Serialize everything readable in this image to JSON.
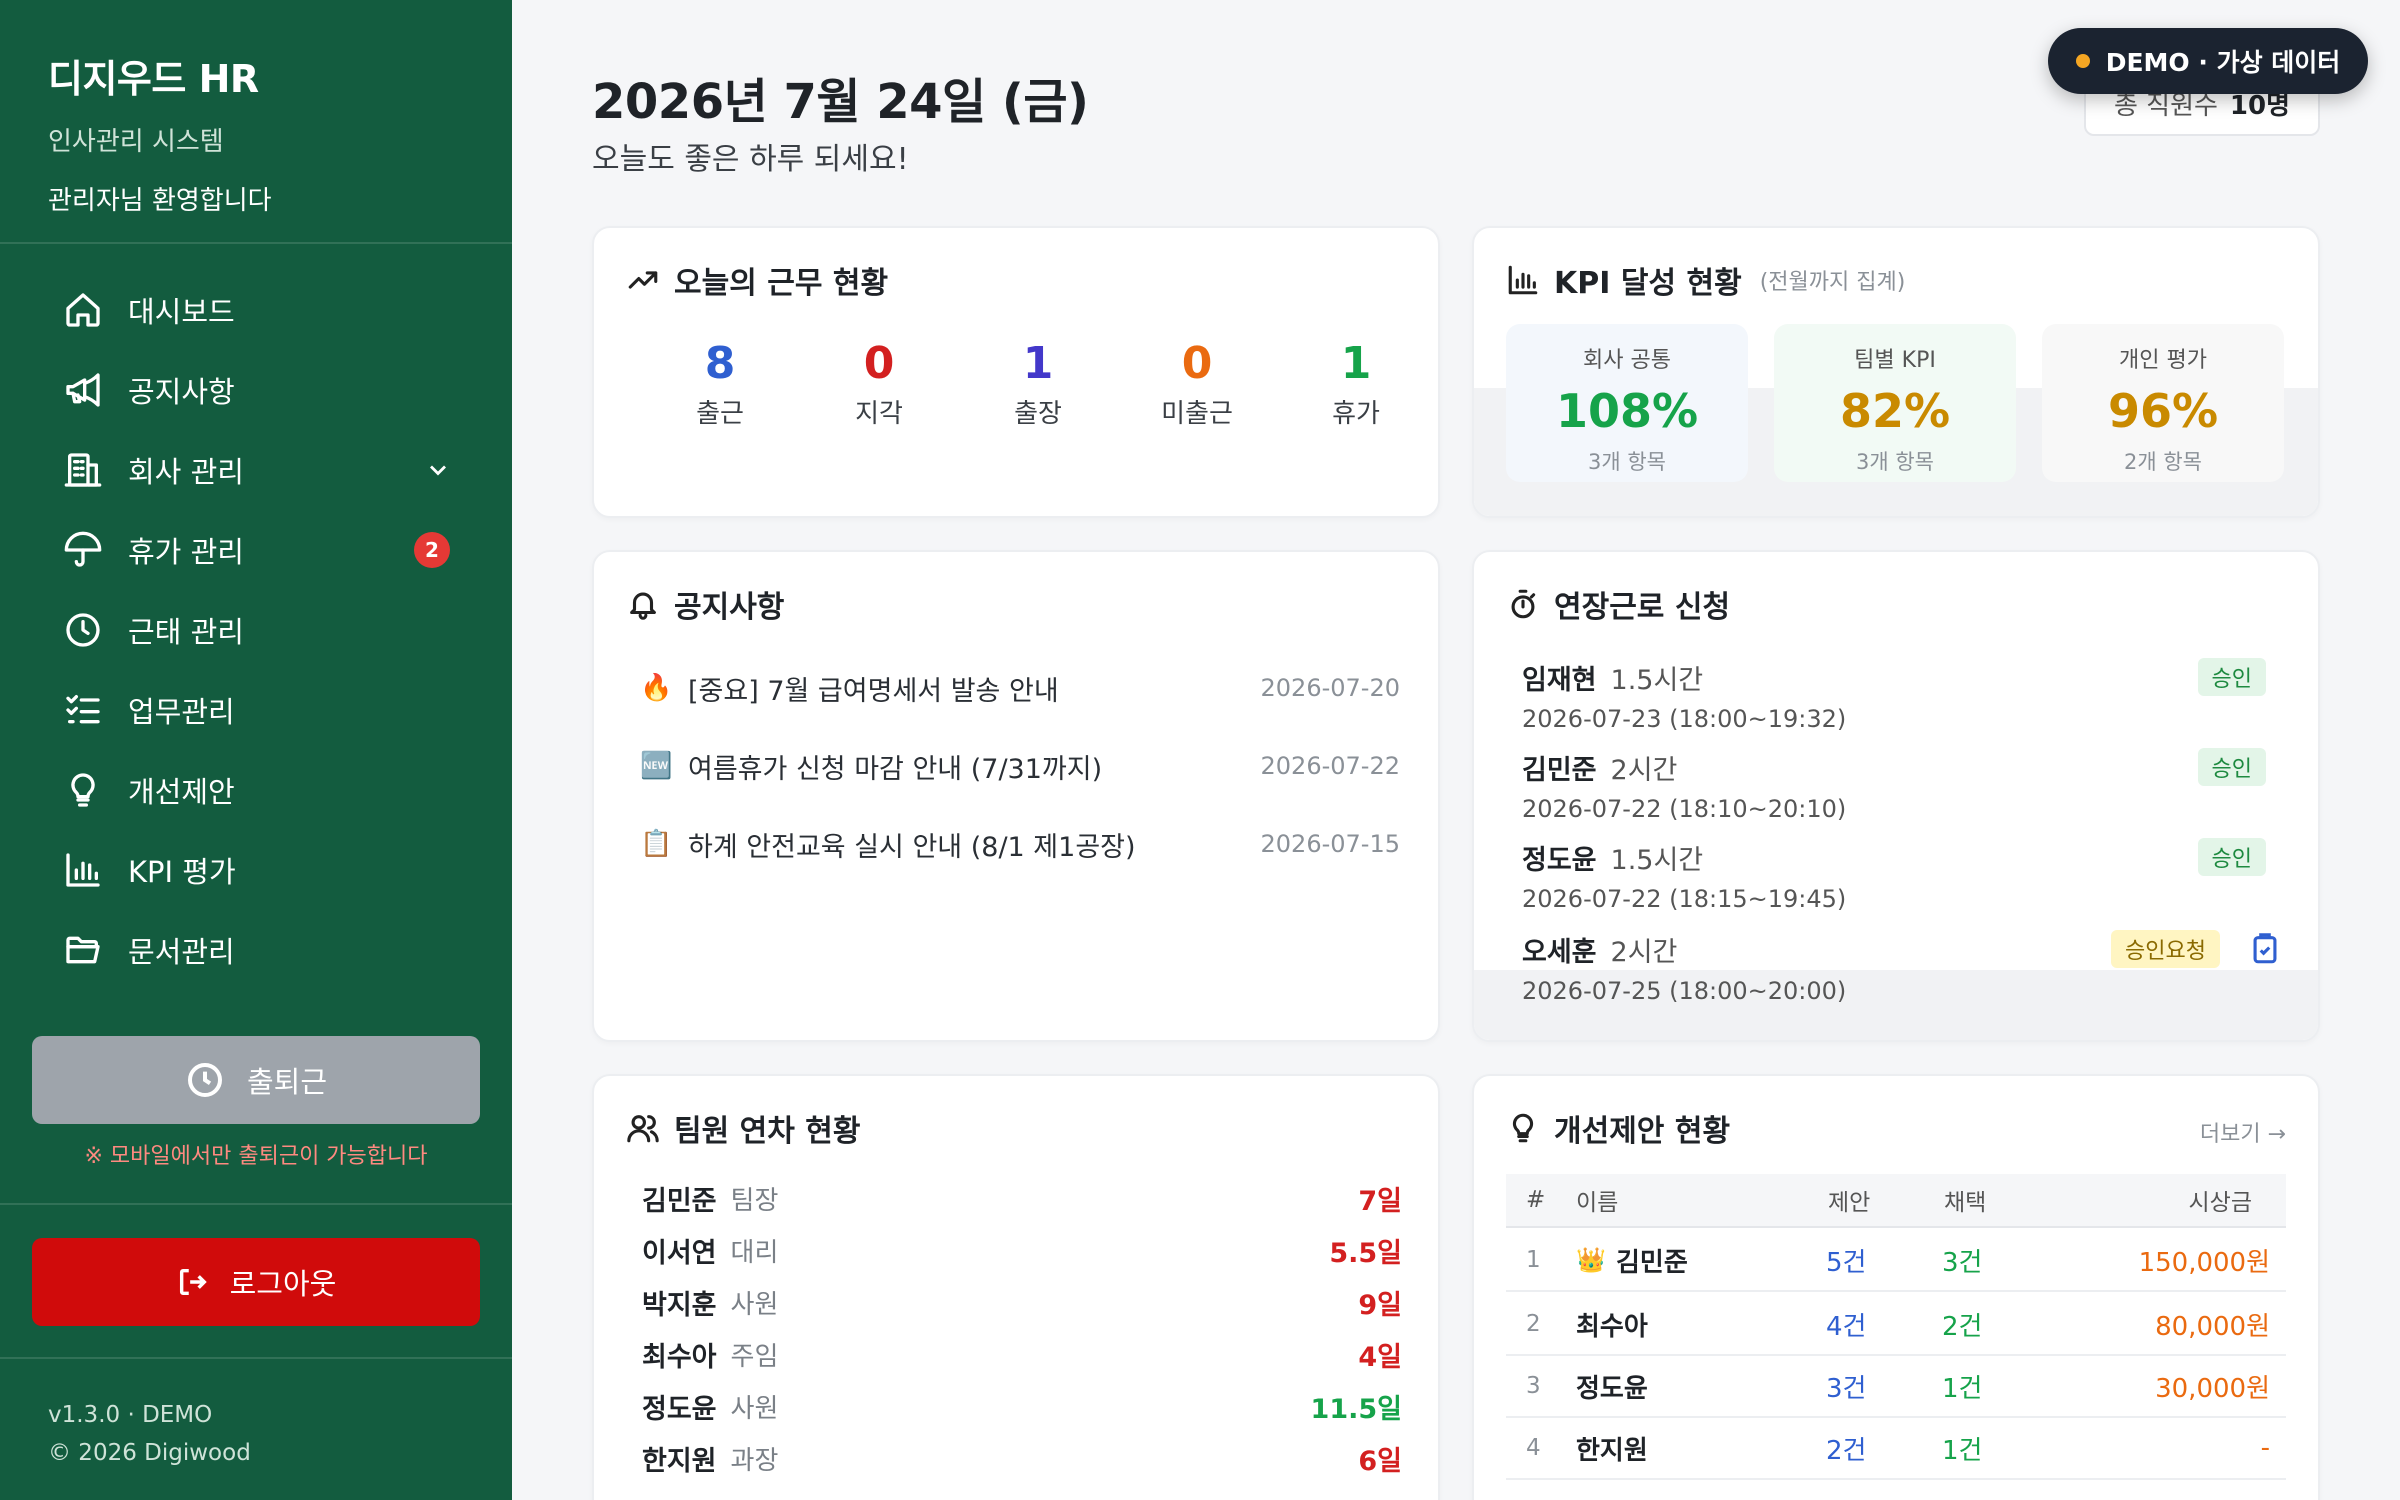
{
  "sidebar": {
    "brand": "디지우드 HR",
    "subtitle": "인사관리 시스템",
    "welcome": "관리자님 환영합니다",
    "nav": [
      {
        "label": "대시보드",
        "icon": "home-icon"
      },
      {
        "label": "공지사항",
        "icon": "megaphone-icon"
      },
      {
        "label": "회사 관리",
        "icon": "building-icon"
      },
      {
        "label": "휴가 관리",
        "icon": "umbrella-icon",
        "badge": "2"
      },
      {
        "label": "근태 관리",
        "icon": "clock-icon"
      },
      {
        "label": "업무관리",
        "icon": "tasklist-icon"
      },
      {
        "label": "개선제안",
        "icon": "lightbulb-icon"
      },
      {
        "label": "KPI 평가",
        "icon": "bar-chart-icon"
      },
      {
        "label": "문서관리",
        "icon": "folder-icon"
      }
    ],
    "clock_button": "출퇴근",
    "mobile_note": "※ 모바일에서만 출퇴근이 가능합니다",
    "logout": "로그아웃",
    "version": "v1.3.0 · DEMO",
    "copyright": "© 2026 Digiwood"
  },
  "header": {
    "date": "2026년 7월 24일 (금)",
    "greeting": "오늘도 좋은 하루 되세요!",
    "employees_label": "총 직원수",
    "employees_value": "10명",
    "demo_badge": "DEMO · 가상 데이터"
  },
  "attendance": {
    "title": "오늘의 근무 현황",
    "items": [
      {
        "value": "8",
        "label": "출근",
        "color": "#2f5fd0"
      },
      {
        "value": "0",
        "label": "지각",
        "color": "#d32020"
      },
      {
        "value": "1",
        "label": "출장",
        "color": "#4338ca"
      },
      {
        "value": "0",
        "label": "미출근",
        "color": "#ea6a10"
      },
      {
        "value": "1",
        "label": "휴가",
        "color": "#16a34a"
      }
    ]
  },
  "kpi": {
    "title": "KPI 달성 현황",
    "note": "(전월까지 집계)",
    "boxes": [
      {
        "label": "회사 공통",
        "value": "108%",
        "count": "3개 항목",
        "color": "#16a34a",
        "bg": "#f3f7fc"
      },
      {
        "label": "팀별 KPI",
        "value": "82%",
        "count": "3개 항목",
        "color": "#c98a00",
        "bg": "#f2faf5"
      },
      {
        "label": "개인 평가",
        "value": "96%",
        "count": "2개 항목",
        "color": "#c98a00",
        "bg": "#f8f8f8"
      }
    ]
  },
  "notices": {
    "title": "공지사항",
    "items": [
      {
        "icon": "🔥",
        "title": "[중요] 7월 급여명세서 발송 안내",
        "date": "2026-07-20"
      },
      {
        "icon": "🆕",
        "title": "여름휴가 신청 마감 안내 (7/31까지)",
        "date": "2026-07-22"
      },
      {
        "icon": "📋",
        "title": "하계 안전교육 실시 안내 (8/1 제1공장)",
        "date": "2026-07-15"
      }
    ]
  },
  "overtime": {
    "title": "연장근로 신청",
    "items": [
      {
        "name": "임재현",
        "hours": "1.5시간",
        "detail": "2026-07-23 (18:00~19:32)",
        "status": "승인"
      },
      {
        "name": "김민준",
        "hours": "2시간",
        "detail": "2026-07-22 (18:10~20:10)",
        "status": "승인"
      },
      {
        "name": "정도윤",
        "hours": "1.5시간",
        "detail": "2026-07-22 (18:15~19:45)",
        "status": "승인"
      },
      {
        "name": "오세훈",
        "hours": "2시간",
        "detail": "2026-07-25 (18:00~20:00)",
        "status": "승인요청"
      }
    ]
  },
  "leave": {
    "title": "팀원 연차 현황",
    "items": [
      {
        "name": "김민준",
        "rank": "팀장",
        "days": "7일",
        "color": "#d32020"
      },
      {
        "name": "이서연",
        "rank": "대리",
        "days": "5.5일",
        "color": "#d32020"
      },
      {
        "name": "박지훈",
        "rank": "사원",
        "days": "9일",
        "color": "#d32020"
      },
      {
        "name": "최수아",
        "rank": "주임",
        "days": "4일",
        "color": "#d32020"
      },
      {
        "name": "정도윤",
        "rank": "사원",
        "days": "11.5일",
        "color": "#16a34a"
      },
      {
        "name": "한지원",
        "rank": "과장",
        "days": "6일",
        "color": "#d32020"
      }
    ]
  },
  "suggestions": {
    "title": "개선제안 현황",
    "more": "더보기 →",
    "columns": [
      "#",
      "이름",
      "제안",
      "채택",
      "시상금"
    ],
    "rows": [
      {
        "rank": "1",
        "crown": "👑",
        "name": "김민준",
        "proposals": "5건",
        "adopted": "3건",
        "reward": "150,000원"
      },
      {
        "rank": "2",
        "crown": "",
        "name": "최수아",
        "proposals": "4건",
        "adopted": "2건",
        "reward": "80,000원"
      },
      {
        "rank": "3",
        "crown": "",
        "name": "정도윤",
        "proposals": "3건",
        "adopted": "1건",
        "reward": "30,000원"
      },
      {
        "rank": "4",
        "crown": "",
        "name": "한지원",
        "proposals": "2건",
        "adopted": "1건",
        "reward": "-"
      }
    ]
  }
}
